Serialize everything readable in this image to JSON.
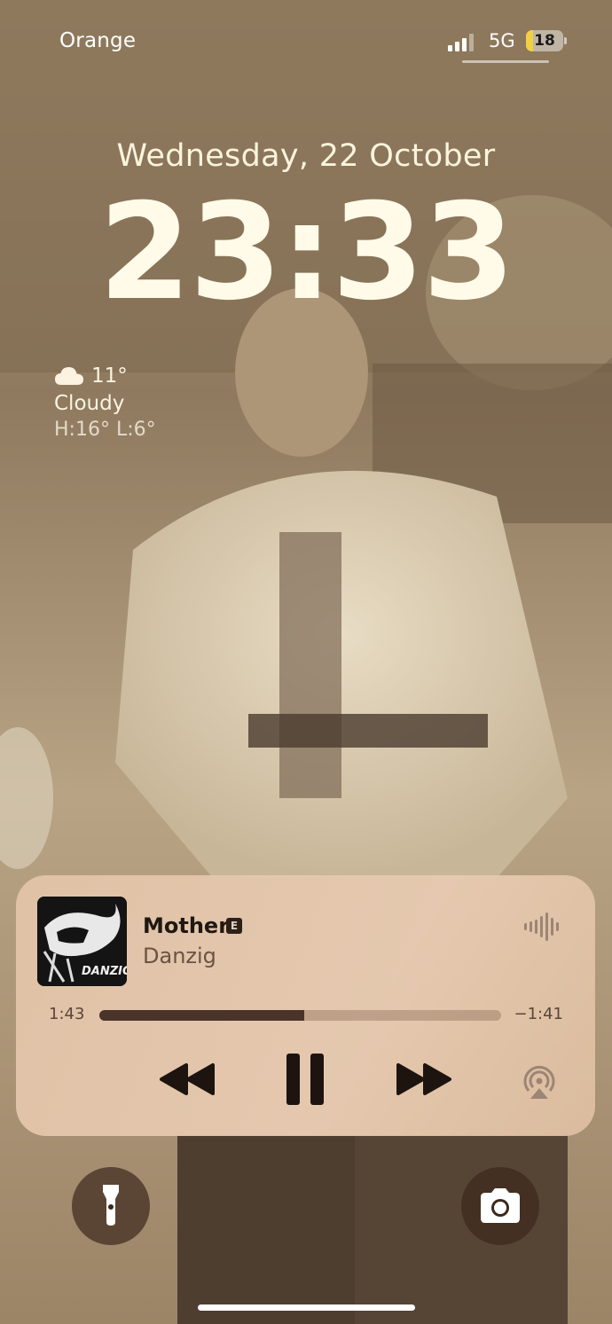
{
  "status_bar": {
    "carrier": "Orange",
    "network": "5G",
    "battery_level": "18",
    "battery_fraction": 0.18,
    "signal_bars": 3,
    "signal_bars_max": 4
  },
  "lock_screen": {
    "date": "Wednesday, 22 October",
    "time": "23:33"
  },
  "weather": {
    "icon": "cloud-icon",
    "temperature": "11°",
    "condition": "Cloudy",
    "high_low": "H:16° L:6°"
  },
  "now_playing": {
    "title": "Mother",
    "explicit_badge": "E",
    "artist": "Danzig",
    "artwork_text": "DANZIG",
    "elapsed": "1:43",
    "remaining": "−1:41",
    "progress_fraction": 0.51,
    "controls": {
      "rewind_icon": "rewind-icon",
      "pause_icon": "pause-icon",
      "forward_icon": "fast-forward-icon",
      "airplay_icon": "airplay-icon",
      "waveform_icon": "waveform-icon"
    }
  },
  "quick_actions": {
    "left_icon": "flashlight-icon",
    "right_icon": "camera-icon"
  },
  "colors": {
    "wallpaper_tone": "#8a7358",
    "player_background": "#e2c4a8",
    "progress_fill": "#4a3328",
    "battery_fill": "#f2d044"
  }
}
